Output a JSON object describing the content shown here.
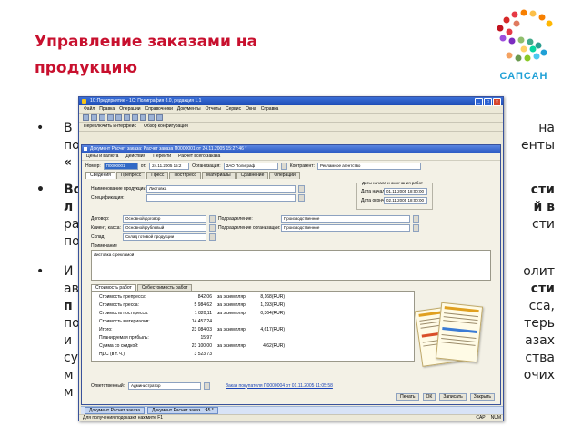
{
  "slide": {
    "title_line1": "Управление заказами на",
    "title_line2": "продукцию",
    "logo_text": "САПСАН",
    "bullet1": {
      "l1_left": "В",
      "l1_right": "на",
      "l2_left": "по",
      "l2_right": "енты",
      "l3_left": "«"
    },
    "bullet2": {
      "l1_left": "Вс",
      "l1_right": "сти",
      "l2_left": "л",
      "l2_right": "й в",
      "l3_left": "ра",
      "l3_right": "сти",
      "l4_left": "по"
    },
    "bullet3": {
      "l1_left": "И",
      "l1_right": "олит",
      "l2_left": "ав",
      "l2_right": "сти",
      "l3_left": "п",
      "l3_right": "сса,",
      "l4_left": "по",
      "l4_right": "терь",
      "l5_left": "и",
      "l5_right": "азах",
      "l6_left": "су",
      "l6_right": "ства",
      "l7_left": "м",
      "l7_right": "очих",
      "l8_left": "м"
    }
  },
  "app": {
    "title": "1С:Предприятие - 1С: Полиграфия 8.0, редакция 1.1",
    "menu": [
      "Файл",
      "Правка",
      "Операции",
      "Справочники",
      "Документы",
      "Отчеты",
      "Сервис",
      "Окна",
      "Справка"
    ],
    "toolbar2": [
      "Переключить интерфейс",
      "Обзор конфигурации"
    ],
    "doc": {
      "title": "Документ Расчет заказа: Расчет заказа П0000001 от 24.11.2005 15:27:46 *",
      "actions": [
        "Цены и валюта",
        "Действия",
        "Перейти",
        "Расчет всего заказа"
      ],
      "number_label": "Номер:",
      "number_value": "П0000001",
      "date_label": "от:",
      "date_value": "24.11.2005 15:2",
      "org_label": "Организация:",
      "org_value": "ЗАО Полиграф",
      "contractor_label": "Контрагент:",
      "contractor_value": "Рекламное агентство",
      "tabs": [
        "Сведения",
        "Препресс",
        "Пресс",
        "Постпресс",
        "Материалы",
        "Сравнение",
        "Операции"
      ],
      "product_label": "Наименование продукции:",
      "product_value": "Листовка",
      "spec_label": "Спецификация:",
      "dates_group": "Даты начала и окончания работ",
      "start_label": "Дата начала:",
      "start_value": "01.11.2005 18:00:00",
      "end_label": "Дата оконч.:",
      "end_value": "02.11.2005 18:00:00",
      "contract_label": "Договор:",
      "contract_value": "Основной договор",
      "subdivision_label": "Подразделение:",
      "subdivision_value": "Производственное",
      "cashier_label": "Клиент, касса:",
      "cashier_value": "Основной рублевый",
      "sub_org_label": "Подразделение организации:",
      "sub_org_value": "Производственное",
      "warehouse_label": "Склад:",
      "warehouse_value": "Склад готовой продукции",
      "note_label": "Примечание",
      "note_value": "Листовка с рекламой",
      "cost_tabs": [
        "Стоимость работ",
        "Себестоимость работ"
      ],
      "cost_rows": [
        {
          "label": "Стоимость препресса:",
          "value": "842,06",
          "unit": "за экземпляр",
          "per": "8,168(RUR)"
        },
        {
          "label": "Стоимость пресса:",
          "value": "5 984,62",
          "unit": "за экземпляр",
          "per": "1,193(RUR)"
        },
        {
          "label": "Стоимость постпресса:",
          "value": "1 820,11",
          "unit": "за экземпляр",
          "per": "0,364(RUR)"
        },
        {
          "label": "Стоимость материалов:",
          "value": "14 457,24",
          "unit": "",
          "per": ""
        },
        {
          "label": "Итого:",
          "value": "23 084,03",
          "unit": "за экземпляр",
          "per": "4,617(RUR)"
        },
        {
          "label": "Планируемая прибыль:",
          "value": "15,97",
          "unit": "",
          "per": ""
        },
        {
          "label": "Сумма со скидкой:",
          "value": "23 100,00",
          "unit": "за экземпляр",
          "per": "4,62(RUR)"
        },
        {
          "label": "НДС (в т. ч.):",
          "value": "3 523,73",
          "unit": "",
          "per": ""
        }
      ],
      "responsible_label": "Ответственный:",
      "responsible_value": "Администратор",
      "link_text": "Заказ покупателя П0000004 от 01.11.2005 11:05:58",
      "buttons": [
        "Печать",
        "ОК",
        "Записать",
        "Закрыть"
      ]
    },
    "taskbar": [
      "Документ Расчет заказа",
      "Документ Расчет заказ...:45 *"
    ],
    "status_text": "Для получения подсказки нажмите F1",
    "status_right": [
      "CAP",
      "NUM"
    ]
  },
  "colors": {
    "title": "#c8102e",
    "logo": "#1fa0d6",
    "accent": "#3169c6"
  }
}
